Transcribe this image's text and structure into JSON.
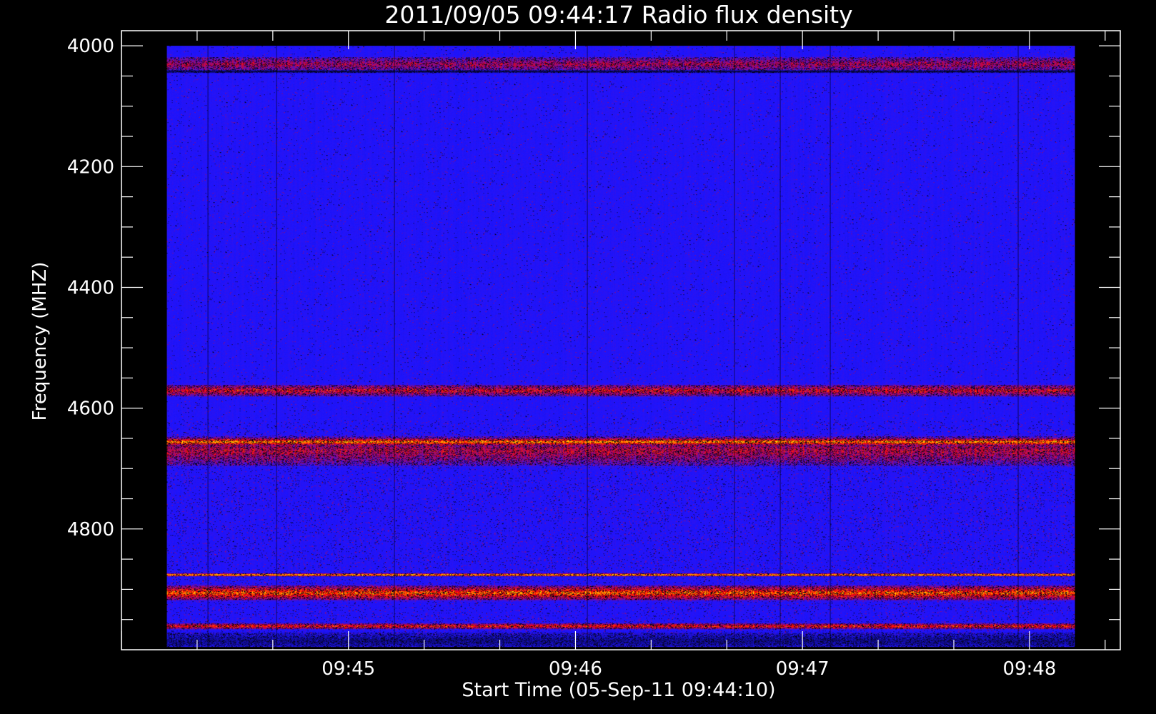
{
  "chart_data": {
    "type": "heatmap",
    "title": "2011/09/05 09:44:17 Radio flux density",
    "xlabel": "Start Time (05-Sep-11 09:44:10)",
    "ylabel": "Frequency (MHZ)",
    "x_ticks": [
      "09:45",
      "09:46",
      "09:47",
      "09:48"
    ],
    "y_ticks": [
      "4000",
      "4200",
      "4400",
      "4600",
      "4800"
    ],
    "x_range_minutes": [
      44.0,
      48.4
    ],
    "data_x_range_minutes": [
      44.2,
      48.2
    ],
    "ylim": [
      3975,
      5000
    ],
    "data_y_range": [
      4000,
      4995
    ],
    "colormap": [
      "#000000",
      "#0000ff",
      "#ff0000",
      "#ffff00"
    ],
    "background_color": "#1e14ff",
    "bands": [
      {
        "freq": 4030,
        "width": 15,
        "intensity": 0.35
      },
      {
        "freq": 4042,
        "width": 3,
        "intensity": -0.9
      },
      {
        "freq": 4570,
        "width": 12,
        "intensity": 0.5
      },
      {
        "freq": 4655,
        "width": 8,
        "intensity": 0.85
      },
      {
        "freq": 4670,
        "width": 30,
        "intensity": 0.4
      },
      {
        "freq": 4875,
        "width": 3,
        "intensity": 1.0
      },
      {
        "freq": 4905,
        "width": 15,
        "intensity": 0.75
      },
      {
        "freq": 4960,
        "width": 6,
        "intensity": 0.6
      },
      {
        "freq": 4985,
        "width": 18,
        "intensity": -0.5
      }
    ],
    "dark_columns_minutes": [
      44.38,
      44.68,
      45.2,
      46.05,
      46.7,
      46.9,
      47.12,
      47.95
    ]
  }
}
